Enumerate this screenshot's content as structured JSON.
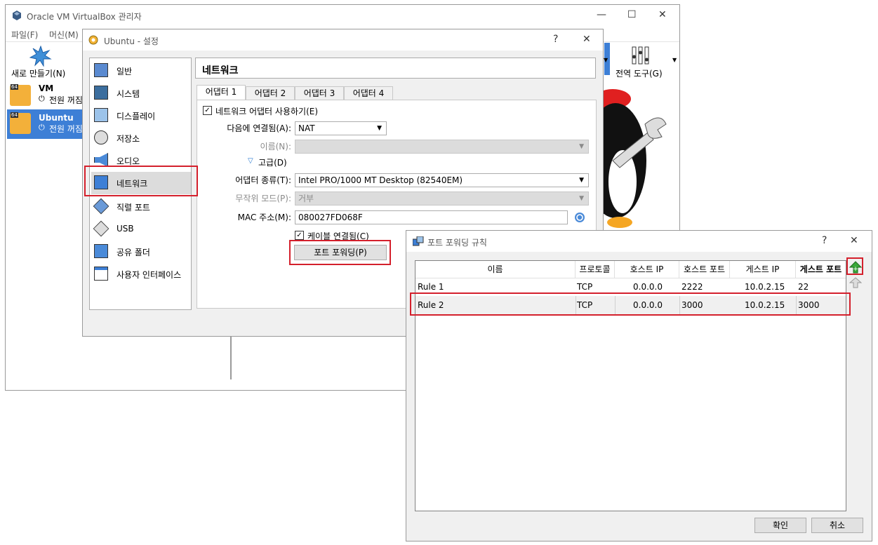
{
  "main_window": {
    "title": "Oracle VM VirtualBox 관리자",
    "menu": [
      "파일(F)",
      "머신(M)"
    ],
    "new_label": "새로 만들기(N)",
    "global_tools_label": "전역 도구(G)",
    "vms": [
      {
        "name": "VM",
        "badge": "64",
        "state": "전원 꺼짐"
      },
      {
        "name": "Ubuntu",
        "badge": "64",
        "state": "전원 꺼짐"
      }
    ]
  },
  "settings": {
    "title": "Ubuntu - 설정",
    "help": "?",
    "close": "✕",
    "nav": [
      "일반",
      "시스템",
      "디스플레이",
      "저장소",
      "오디오",
      "네트워크",
      "직렬 포트",
      "USB",
      "공유 폴더",
      "사용자 인터페이스"
    ],
    "section_title": "네트워크",
    "tabs": [
      "어댑터 1",
      "어댑터 2",
      "어댑터 3",
      "어댑터 4"
    ],
    "enable_adapter": "네트워크 어댑터 사용하기(E)",
    "attached_label": "다음에 연결됨(A):",
    "attached_value": "NAT",
    "name_label": "이름(N):",
    "name_value": "",
    "advanced_label": "고급(D)",
    "adapter_type_label": "어댑터 종류(T):",
    "adapter_type_value": "Intel PRO/1000 MT Desktop (82540EM)",
    "promisc_label": "무작위 모드(P):",
    "promisc_value": "거부",
    "mac_label": "MAC 주소(M):",
    "mac_value": "080027FD068F",
    "cable_label": "케이블 연결됨(C)",
    "port_forward_button": "포트 포워딩(P)"
  },
  "port_forwarding": {
    "title": "포트 포워딩 규칙",
    "help": "?",
    "close": "✕",
    "columns": [
      "이름",
      "프로토콜",
      "호스트 IP",
      "호스트 포트",
      "게스트 IP",
      "게스트 포트"
    ],
    "rows": [
      [
        "Rule 1",
        "TCP",
        "0.0.0.0",
        "2222",
        "10.0.2.15",
        "22"
      ],
      [
        "Rule 2",
        "TCP",
        "0.0.0.0",
        "3000",
        "10.0.2.15",
        "3000"
      ]
    ],
    "ok": "확인",
    "cancel": "취소"
  }
}
